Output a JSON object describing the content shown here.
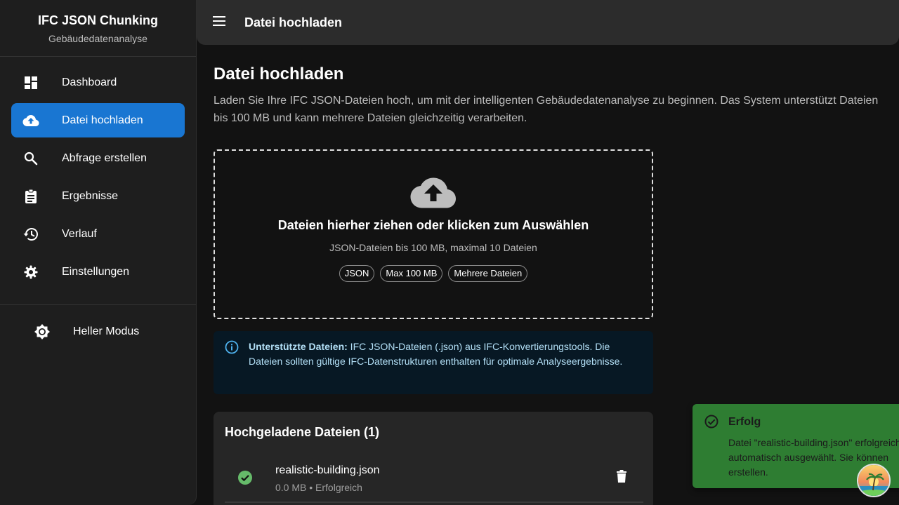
{
  "sidebar": {
    "brand_title": "IFC JSON Chunking",
    "brand_subtitle": "Gebäudedatenanalyse",
    "items": [
      {
        "label": "Dashboard",
        "icon": "dashboard-icon"
      },
      {
        "label": "Datei hochladen",
        "icon": "cloud-upload-icon",
        "active": true
      },
      {
        "label": "Abfrage erstellen",
        "icon": "search-icon"
      },
      {
        "label": "Ergebnisse",
        "icon": "clipboard-icon"
      },
      {
        "label": "Verlauf",
        "icon": "history-icon"
      },
      {
        "label": "Einstellungen",
        "icon": "gear-icon"
      }
    ],
    "mode_toggle": {
      "label": "Heller Modus",
      "icon": "brightness-icon"
    }
  },
  "topbar": {
    "title": "Datei hochladen",
    "menu_icon": "menu-icon"
  },
  "main": {
    "title": "Datei hochladen",
    "description": "Laden Sie Ihre IFC JSON-Dateien hoch, um mit der intelligenten Gebäudedatenanalyse zu beginnen. Das System unterstützt Dateien bis 100 MB und kann mehrere Dateien gleichzeitig verarbeiten."
  },
  "dropzone": {
    "title": "Dateien hierher ziehen oder klicken zum Auswählen",
    "subtitle": "JSON-Dateien bis 100 MB, maximal 10 Dateien",
    "chips": [
      "JSON",
      "Max 100 MB",
      "Mehrere Dateien"
    ]
  },
  "info": {
    "label": "Unterstützte Dateien:",
    "text": " IFC JSON-Dateien (.json) aus IFC-Konvertierungstools. Die Dateien sollten gültige IFC-Datenstrukturen enthalten für optimale Analyseergebnisse."
  },
  "uploads": {
    "title": "Hochgeladene Dateien (1)",
    "files": [
      {
        "name": "realistic-building.json",
        "meta": "0.0 MB • Erfolgreich",
        "status": "success"
      }
    ]
  },
  "toast": {
    "title": "Erfolg",
    "lines": [
      "Datei \"realistic-building.json\" erfolgreich",
      "automatisch ausgewählt. Sie können",
      "erstellen."
    ]
  },
  "colors": {
    "accent": "#1976d2",
    "success": "#2e7d32",
    "info_bg": "#071824",
    "info_text": "#b3e0f7"
  }
}
